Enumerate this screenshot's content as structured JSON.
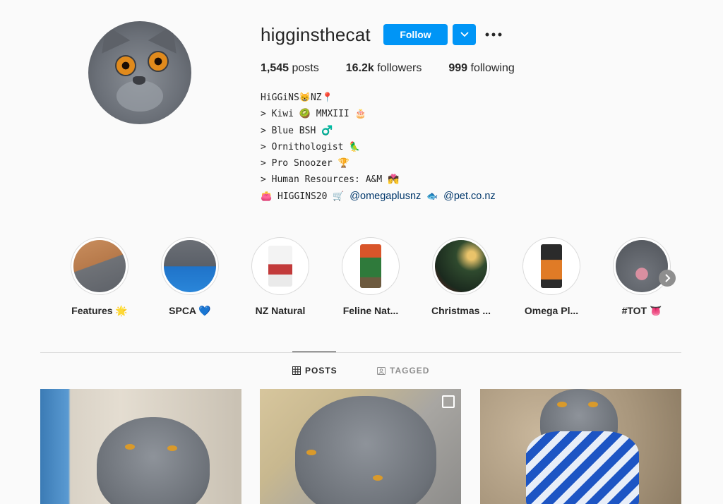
{
  "profile": {
    "username": "higginsthecat",
    "follow_label": "Follow",
    "posts_count": "1,545",
    "posts_label": " posts",
    "followers_count": "16.2k",
    "followers_label": " followers",
    "following_count": "999",
    "following_label": " following"
  },
  "bio": {
    "line1": "HiGGiNS😸NZ📍",
    "line2": "> Kiwi 🥝 MMXIII 🎂",
    "line3": "> Blue BSH ♂️",
    "line4": "> Ornithologist 🦜",
    "line5": "> Pro Snoozer 🏆",
    "line6": "> Human Resources: A&M 💏",
    "line7_prefix": "👛 HIGGINS20 🛒 ",
    "link1": "@omegaplusnz",
    "line7_mid": " 🐟 ",
    "link2": "@pet.co.nz"
  },
  "highlights": [
    {
      "label": "Features 🌟"
    },
    {
      "label": "SPCA 💙"
    },
    {
      "label": "NZ Natural"
    },
    {
      "label": "Feline Nat..."
    },
    {
      "label": "Christmas ..."
    },
    {
      "label": "Omega Pl..."
    },
    {
      "label": "#TOT 👅"
    }
  ],
  "tabs": {
    "posts": "POSTS",
    "tagged": "TAGGED"
  },
  "colors": {
    "accent": "#0095f6",
    "link": "#00376b",
    "text": "#262626",
    "muted": "#8e8e8e",
    "background": "#fafafa"
  },
  "icons": {
    "dropdown": "chevron-down-icon",
    "more": "more-horizontal-icon",
    "next": "chevron-right-icon",
    "posts_tab": "grid-icon",
    "tagged_tab": "tagged-icon",
    "multi_post": "multiple-posts-icon"
  }
}
